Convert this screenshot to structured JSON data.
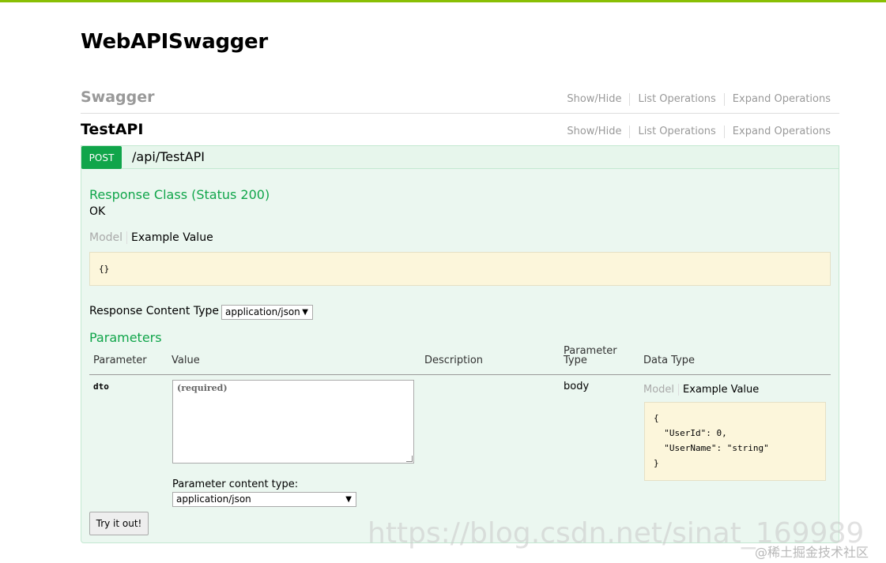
{
  "app_title": "WebAPISwagger",
  "resources": [
    {
      "name": "Swagger",
      "ops": [
        "Show/Hide",
        "List Operations",
        "Expand Operations"
      ]
    },
    {
      "name": "TestAPI",
      "ops": [
        "Show/Hide",
        "List Operations",
        "Expand Operations"
      ]
    }
  ],
  "operation": {
    "method": "POST",
    "path": "/api/TestAPI",
    "response_class_title": "Response Class (Status 200)",
    "response_class_value": "OK",
    "model_tab": "Model",
    "example_tab": "Example Value",
    "response_example": "{}",
    "response_content_type_label": "Response Content Type",
    "response_content_type_value": "application/json",
    "parameters_title": "Parameters",
    "param_headers": {
      "parameter": "Parameter",
      "value": "Value",
      "description": "Description",
      "parameter_type_line1": "Parameter",
      "parameter_type_line2": "Type",
      "data_type": "Data Type"
    },
    "param": {
      "name": "dto",
      "placeholder": "(required)",
      "param_type": "body",
      "example": "{\n  \"UserId\": 0,\n  \"UserName\": \"string\"\n}",
      "content_type_label": "Parameter content type:",
      "content_type_value": "application/json"
    },
    "try_button": "Try it out!"
  },
  "watermarks": {
    "url": "https://blog.csdn.net/sinat_169989",
    "site": "@稀土掘金技术社区"
  }
}
